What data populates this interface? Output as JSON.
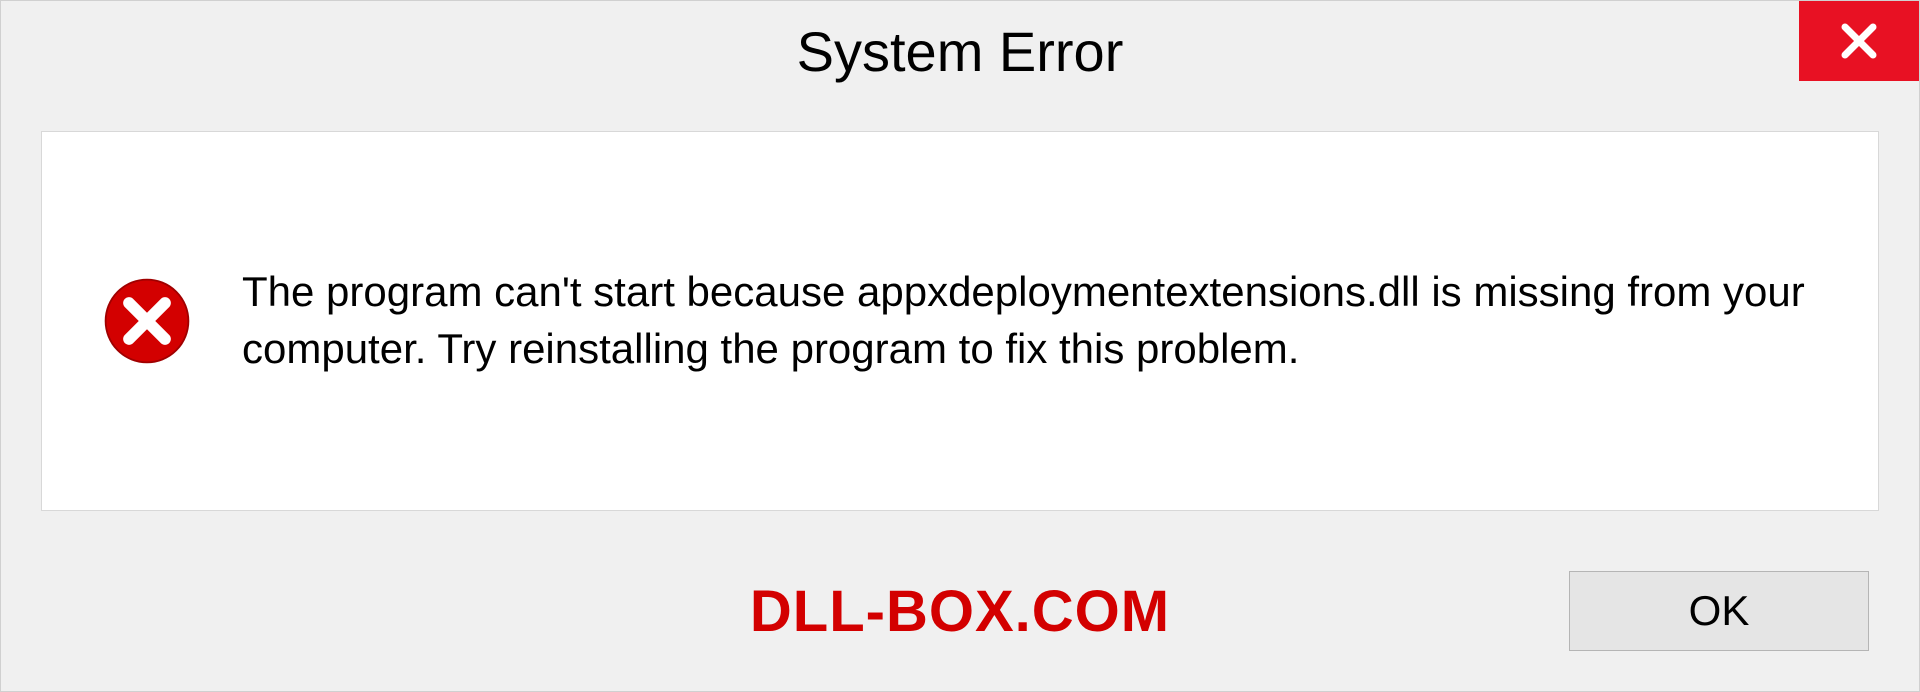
{
  "dialog": {
    "title": "System Error",
    "message": "The program can't start because appxdeploymentextensions.dll is missing from your computer. Try reinstalling the program to fix this problem.",
    "ok_label": "OK"
  },
  "watermark": "DLL-BOX.COM",
  "icons": {
    "close": "close-icon",
    "error": "error-icon"
  },
  "colors": {
    "close_bg": "#e81123",
    "error_red": "#d30000",
    "watermark_red": "#d30000"
  }
}
